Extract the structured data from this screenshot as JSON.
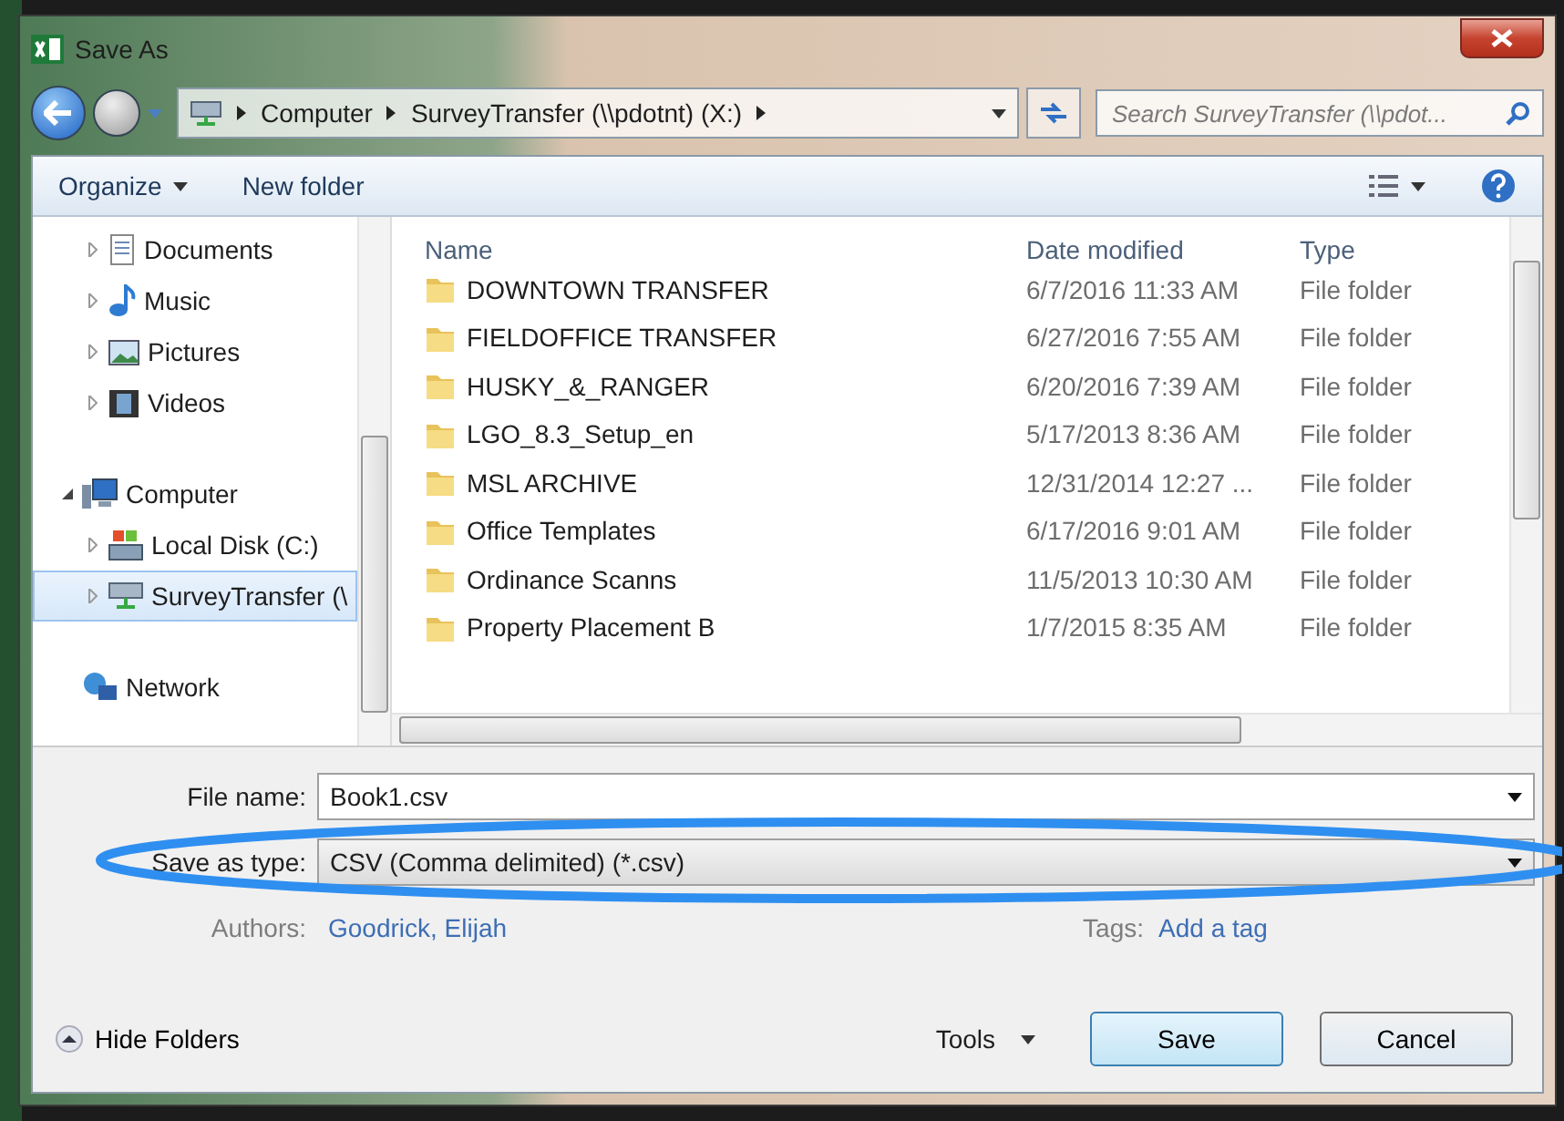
{
  "window": {
    "title": "Save As"
  },
  "address": {
    "crumbs": [
      "Computer",
      "SurveyTransfer (\\\\pdotnt) (X:)"
    ]
  },
  "search": {
    "placeholder": "Search SurveyTransfer (\\\\pdot..."
  },
  "toolbar": {
    "organize": "Organize",
    "new_folder": "New folder"
  },
  "nav": {
    "items": [
      {
        "label": "Documents",
        "kind": "documents",
        "expanded": false,
        "selected": false
      },
      {
        "label": "Music",
        "kind": "music",
        "expanded": false,
        "selected": false
      },
      {
        "label": "Pictures",
        "kind": "pictures",
        "expanded": false,
        "selected": false
      },
      {
        "label": "Videos",
        "kind": "videos",
        "expanded": false,
        "selected": false
      },
      {
        "label": "Computer",
        "kind": "computer",
        "expanded": true,
        "selected": false,
        "children": [
          {
            "label": "Local Disk (C:)",
            "kind": "disk",
            "expanded": false,
            "selected": false
          },
          {
            "label": "SurveyTransfer (\\",
            "kind": "network-drive",
            "expanded": false,
            "selected": true
          }
        ]
      },
      {
        "label": "Network",
        "kind": "network",
        "selected": false
      }
    ]
  },
  "table": {
    "columns": [
      "Name",
      "Date modified",
      "Type"
    ],
    "rows": [
      {
        "name": "DOWNTOWN TRANSFER",
        "date": "6/7/2016 11:33 AM",
        "type": "File folder"
      },
      {
        "name": "FIELDOFFICE TRANSFER",
        "date": "6/27/2016 7:55 AM",
        "type": "File folder"
      },
      {
        "name": "HUSKY_&_RANGER",
        "date": "6/20/2016 7:39 AM",
        "type": "File folder"
      },
      {
        "name": "LGO_8.3_Setup_en",
        "date": "5/17/2013 8:36 AM",
        "type": "File folder"
      },
      {
        "name": "MSL ARCHIVE",
        "date": "12/31/2014 12:27 ...",
        "type": "File folder"
      },
      {
        "name": "Office Templates",
        "date": "6/17/2016 9:01 AM",
        "type": "File folder"
      },
      {
        "name": "Ordinance Scanns",
        "date": "11/5/2013 10:30 AM",
        "type": "File folder"
      },
      {
        "name": "Property Placement B",
        "date": "1/7/2015 8:35 AM",
        "type": "File folder"
      }
    ]
  },
  "form": {
    "file_name_label": "File name:",
    "file_name": "Book1.csv",
    "type_label": "Save as type:",
    "type": "CSV (Comma delimited) (*.csv)",
    "authors_label": "Authors:",
    "authors": "Goodrick, Elijah",
    "tags_label": "Tags:",
    "tags": "Add a tag"
  },
  "footer": {
    "hide_folders": "Hide Folders",
    "tools": "Tools",
    "save": "Save",
    "cancel": "Cancel"
  },
  "highlight": {
    "kind": "ellipse"
  }
}
